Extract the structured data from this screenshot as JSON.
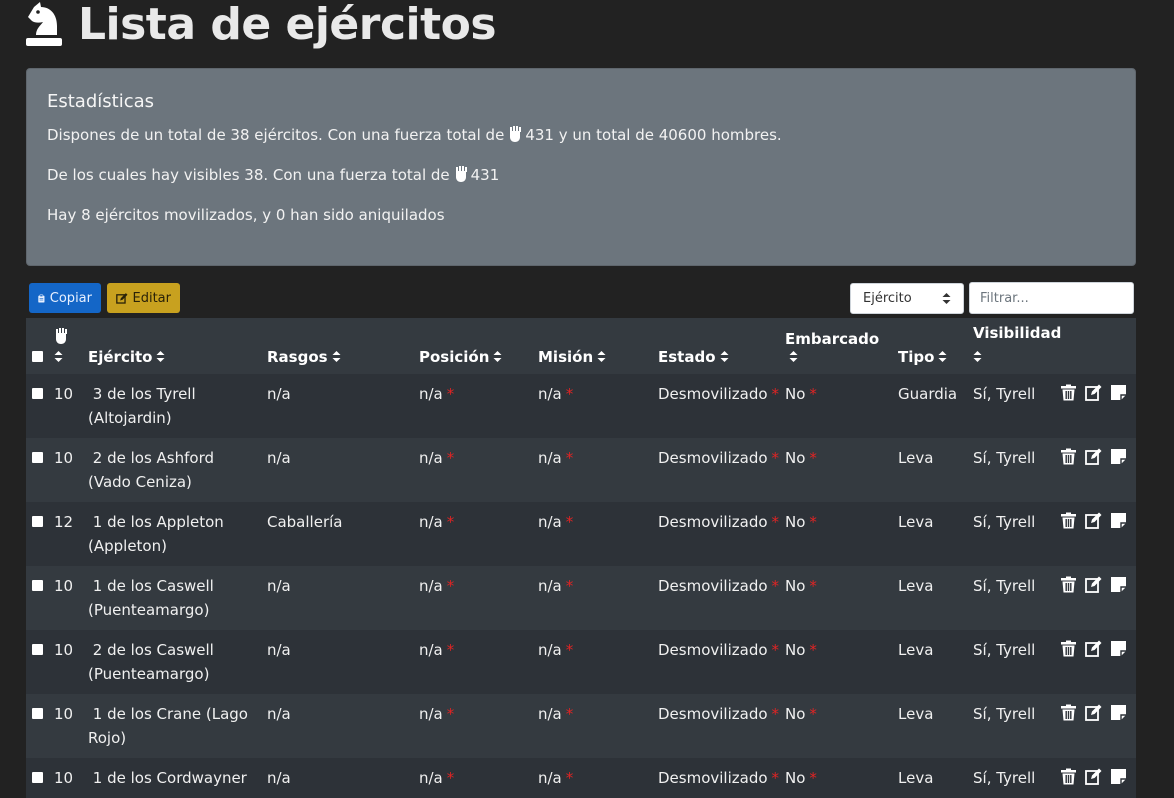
{
  "page": {
    "title": "Lista de ejércitos"
  },
  "stats": {
    "heading": "Estadísticas",
    "line1_pre": "Dispones de un total de 38 ejércitos. Con una fuerza total de",
    "line1_post": "431 y un total de 40600 hombres.",
    "line2_pre": "De los cuales hay visibles 38. Con una fuerza total de",
    "line2_post": "431",
    "line3": "Hay 8 ejércitos movilizados, y 0 han sido aniquilados"
  },
  "toolbar": {
    "copy_label": "Copiar",
    "edit_label": "Editar",
    "select_value": "Ejército",
    "filter_placeholder": "Filtrar..."
  },
  "table": {
    "headers": {
      "ejercito": "Ejército",
      "rasgos": "Rasgos",
      "posicion": "Posición",
      "mision": "Misión",
      "estado": "Estado",
      "embarcado": "Embarcado",
      "tipo": "Tipo",
      "visibilidad": "Visibilidad"
    },
    "required_mark": "*",
    "rows": [
      {
        "fuerza": "10",
        "ejercito": " 3 de los Tyrell (Altojardin)",
        "rasgos": "n/a",
        "posicion": "n/a",
        "mision": "n/a",
        "estado": "Desmovilizado",
        "embarcado": "No",
        "tipo": "Guardia",
        "visibilidad": "Sí, Tyrell"
      },
      {
        "fuerza": "10",
        "ejercito": " 2 de los Ashford (Vado Ceniza)",
        "rasgos": "n/a",
        "posicion": "n/a",
        "mision": "n/a",
        "estado": "Desmovilizado",
        "embarcado": "No",
        "tipo": "Leva",
        "visibilidad": "Sí, Tyrell"
      },
      {
        "fuerza": "12",
        "ejercito": " 1 de los Appleton (Appleton)",
        "rasgos": "Caballería",
        "posicion": "n/a",
        "mision": "n/a",
        "estado": "Desmovilizado",
        "embarcado": "No",
        "tipo": "Leva",
        "visibilidad": "Sí, Tyrell"
      },
      {
        "fuerza": "10",
        "ejercito": " 1 de los Caswell (Puenteamargo)",
        "rasgos": "n/a",
        "posicion": "n/a",
        "mision": "n/a",
        "estado": "Desmovilizado",
        "embarcado": "No",
        "tipo": "Leva",
        "visibilidad": "Sí, Tyrell"
      },
      {
        "fuerza": "10",
        "ejercito": " 2 de los Caswell (Puenteamargo)",
        "rasgos": "n/a",
        "posicion": "n/a",
        "mision": "n/a",
        "estado": "Desmovilizado",
        "embarcado": "No",
        "tipo": "Leva",
        "visibilidad": "Sí, Tyrell"
      },
      {
        "fuerza": "10",
        "ejercito": " 1 de los Crane (Lago Rojo)",
        "rasgos": "n/a",
        "posicion": "n/a",
        "mision": "n/a",
        "estado": "Desmovilizado",
        "embarcado": "No",
        "tipo": "Leva",
        "visibilidad": "Sí, Tyrell"
      },
      {
        "fuerza": "10",
        "ejercito": " 1 de los Cordwayner",
        "rasgos": "n/a",
        "posicion": "n/a",
        "mision": "n/a",
        "estado": "Desmovilizado",
        "embarcado": "No",
        "tipo": "Leva",
        "visibilidad": "Sí, Tyrell"
      }
    ]
  },
  "icons": {
    "title": "chess-knight-icon",
    "fuerza": "fist-icon",
    "sort": "sort-icon",
    "delete": "trash-icon",
    "edit": "edit-icon",
    "note": "note-icon",
    "copy": "clipboard-icon"
  }
}
